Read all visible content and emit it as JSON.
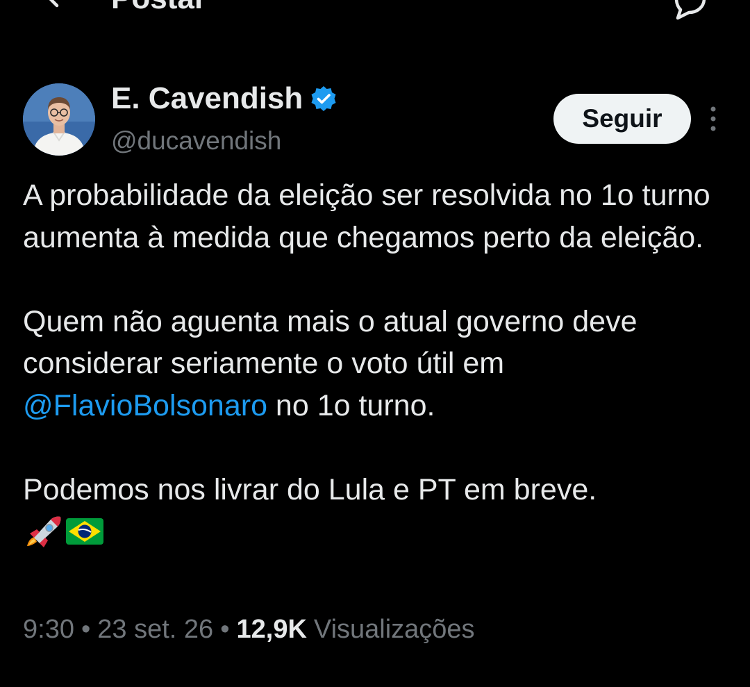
{
  "header": {
    "title": "Postar"
  },
  "author": {
    "name": "E. Cavendish",
    "handle": "@ducavendish",
    "verified": true,
    "verified_color": "#1d9bf0"
  },
  "actions": {
    "follow_label": "Seguir"
  },
  "tweet": {
    "paragraph_1": "A probabilidade da eleição ser resolvida no 1o turno aumenta à medida que chegamos perto da eleição.",
    "paragraph_2_before": "Quem não aguenta mais o atual governo deve considerar seriamente o voto útil em ",
    "paragraph_2_mention": "@FlavioBolsonaro",
    "paragraph_2_after": " no 1o turno.",
    "paragraph_3": "Podemos nos livrar do Lula e PT em breve.",
    "emojis": [
      "rocket-emoji",
      "brazil-flag-emoji"
    ]
  },
  "meta": {
    "time": "9:30",
    "separator": "•",
    "date": "23 set. 26",
    "views_count": "12,9K",
    "views_label": "Visualizações"
  },
  "colors": {
    "background": "#000000",
    "text_primary": "#e7e9ea",
    "text_secondary": "#71767b",
    "link": "#1d9bf0",
    "follow_bg": "#eff3f4"
  }
}
